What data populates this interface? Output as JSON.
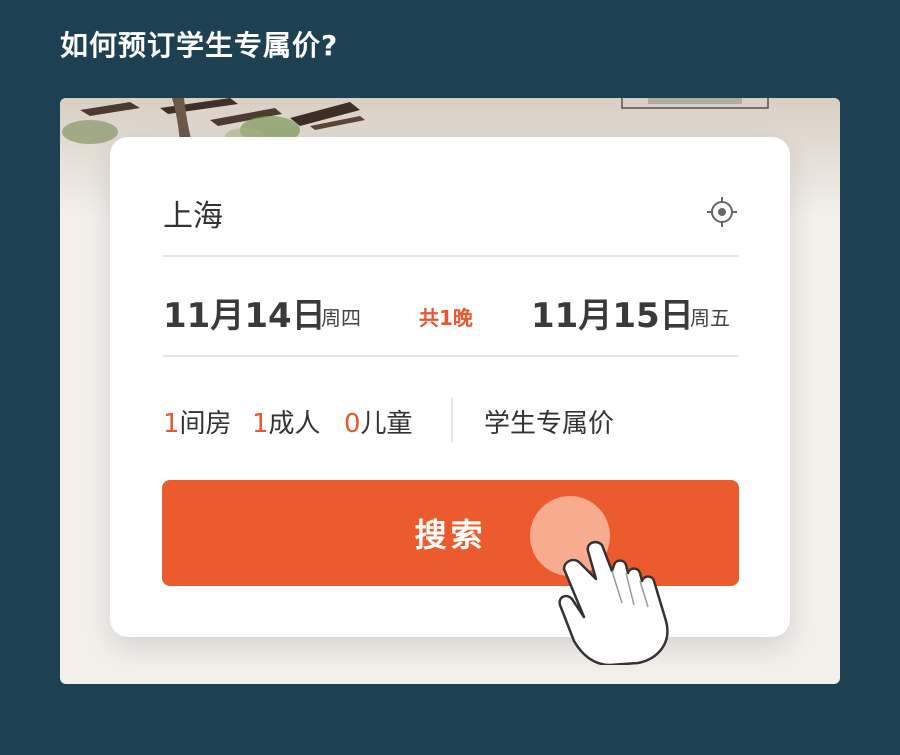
{
  "header": {
    "title": "如何预订学生专属价?"
  },
  "booking": {
    "city": "上海",
    "check_in": {
      "date": "11月14日",
      "weekday": "周四"
    },
    "nights": "共1晚",
    "check_out": {
      "date": "11月15日",
      "weekday": "周五"
    },
    "rooms": {
      "count": "1",
      "label": "间房"
    },
    "adults": {
      "count": "1",
      "label": "成人"
    },
    "children": {
      "count": "0",
      "label": "儿童"
    },
    "student_price_label": "学生专属价",
    "search_label": "搜索"
  },
  "icons": {
    "locate": "crosshair-icon",
    "hand": "pointing-hand-icon"
  },
  "colors": {
    "background": "#1d4153",
    "accent": "#ec5b2e",
    "highlight_text": "#e8572e"
  }
}
